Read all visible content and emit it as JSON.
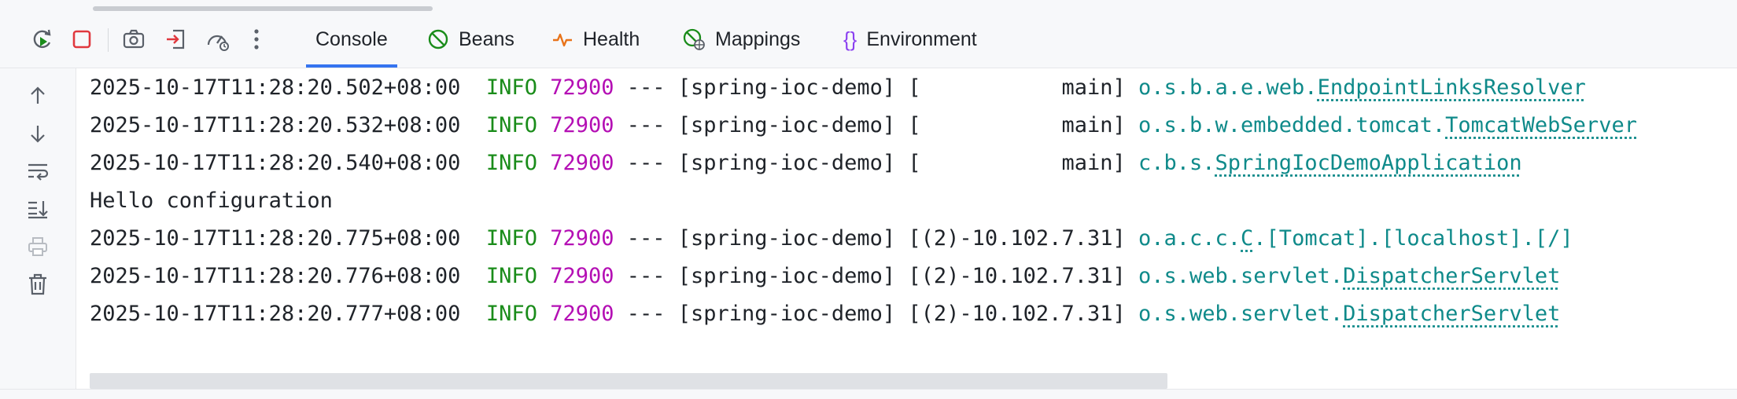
{
  "toolbar": {
    "icons": [
      {
        "name": "rerun-icon"
      },
      {
        "name": "stop-icon"
      },
      {
        "name": "camera-icon"
      },
      {
        "name": "exit-icon"
      },
      {
        "name": "gauge-icon"
      },
      {
        "name": "more-vertical-icon"
      }
    ],
    "tabs": [
      {
        "label": "Console",
        "icon": "console",
        "active": true
      },
      {
        "label": "Beans",
        "icon": "beans-icon"
      },
      {
        "label": "Health",
        "icon": "health-icon"
      },
      {
        "label": "Mappings",
        "icon": "mappings-icon"
      },
      {
        "label": "Environment",
        "icon": "environment-icon"
      }
    ]
  },
  "sidebar": {
    "icons": [
      "arrow-up-icon",
      "arrow-down-icon",
      "soft-wrap-icon",
      "scroll-to-end-icon",
      "print-icon",
      "trash-icon"
    ]
  },
  "colors": {
    "accent": "#3574f0",
    "info": "#1a8c1a",
    "pid": "#b40fb4",
    "logger": "#0f8a8a",
    "stop": "#e0383e"
  },
  "console": {
    "lines": [
      {
        "ts": "2025-10-17T11:28:20.502+08:00",
        "level": "INFO",
        "pid": "72900",
        "mid": " --- [spring-ioc-demo] [           main] ",
        "logger_prefix": "o.s.b.a.e.web.",
        "logger_link": "EndpointLinksResolver"
      },
      {
        "ts": "2025-10-17T11:28:20.532+08:00",
        "level": "INFO",
        "pid": "72900",
        "mid": " --- [spring-ioc-demo] [           main] ",
        "logger_prefix": "o.s.b.w.embedded.tomcat.",
        "logger_link": "TomcatWebServer"
      },
      {
        "ts": "2025-10-17T11:28:20.540+08:00",
        "level": "INFO",
        "pid": "72900",
        "mid": " --- [spring-ioc-demo] [           main] ",
        "logger_prefix": "c.b.s.",
        "logger_link": "SpringIocDemoApplication"
      },
      {
        "plain": "Hello configuration"
      },
      {
        "ts": "2025-10-17T11:28:20.775+08:00",
        "level": "INFO",
        "pid": "72900",
        "mid": " --- [spring-ioc-demo] [(2)-10.102.7.31] ",
        "logger_prefix": "o.a.c.c.",
        "logger_link": "C",
        "logger_suffix": ".[Tomcat].[localhost].[/]"
      },
      {
        "ts": "2025-10-17T11:28:20.776+08:00",
        "level": "INFO",
        "pid": "72900",
        "mid": " --- [spring-ioc-demo] [(2)-10.102.7.31] ",
        "logger_prefix": "o.s.web.servlet.",
        "logger_link": "DispatcherServlet"
      },
      {
        "ts": "2025-10-17T11:28:20.777+08:00",
        "level": "INFO",
        "pid": "72900",
        "mid": " --- [spring-ioc-demo] [(2)-10.102.7.31] ",
        "logger_prefix": "o.s.web.servlet.",
        "logger_link": "DispatcherServlet"
      }
    ]
  }
}
